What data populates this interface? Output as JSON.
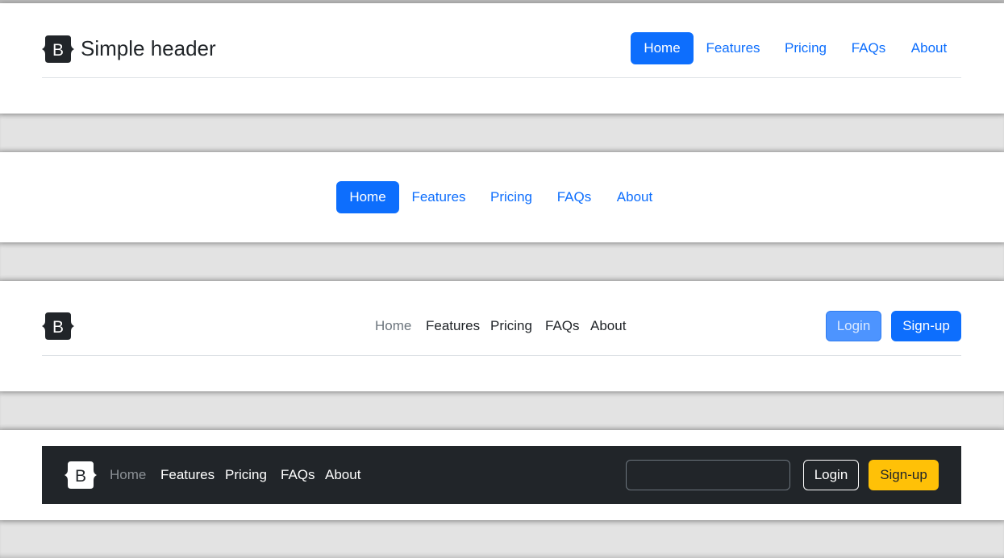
{
  "colors": {
    "primary": "#0d6efd",
    "dark": "#212529",
    "warning": "#ffc107",
    "muted": "#6c757d"
  },
  "header1": {
    "logo_icon": "bootstrap-logo-icon",
    "logo_letter": "B",
    "title": "Simple header",
    "nav": [
      "Home",
      "Features",
      "Pricing",
      "FAQs",
      "About"
    ]
  },
  "header2": {
    "nav": [
      "Home",
      "Features",
      "Pricing",
      "FAQs",
      "About"
    ]
  },
  "header3": {
    "logo_icon": "bootstrap-logo-icon",
    "logo_letter": "B",
    "nav": [
      "Home",
      "Features",
      "Pricing",
      "FAQs",
      "About"
    ],
    "login_label": "Login",
    "signup_label": "Sign-up"
  },
  "header4": {
    "logo_icon": "bootstrap-logo-icon",
    "logo_letter": "B",
    "nav": [
      "Home",
      "Features",
      "Pricing",
      "FAQs",
      "About"
    ],
    "search_placeholder": "",
    "login_label": "Login",
    "signup_label": "Sign-up"
  }
}
